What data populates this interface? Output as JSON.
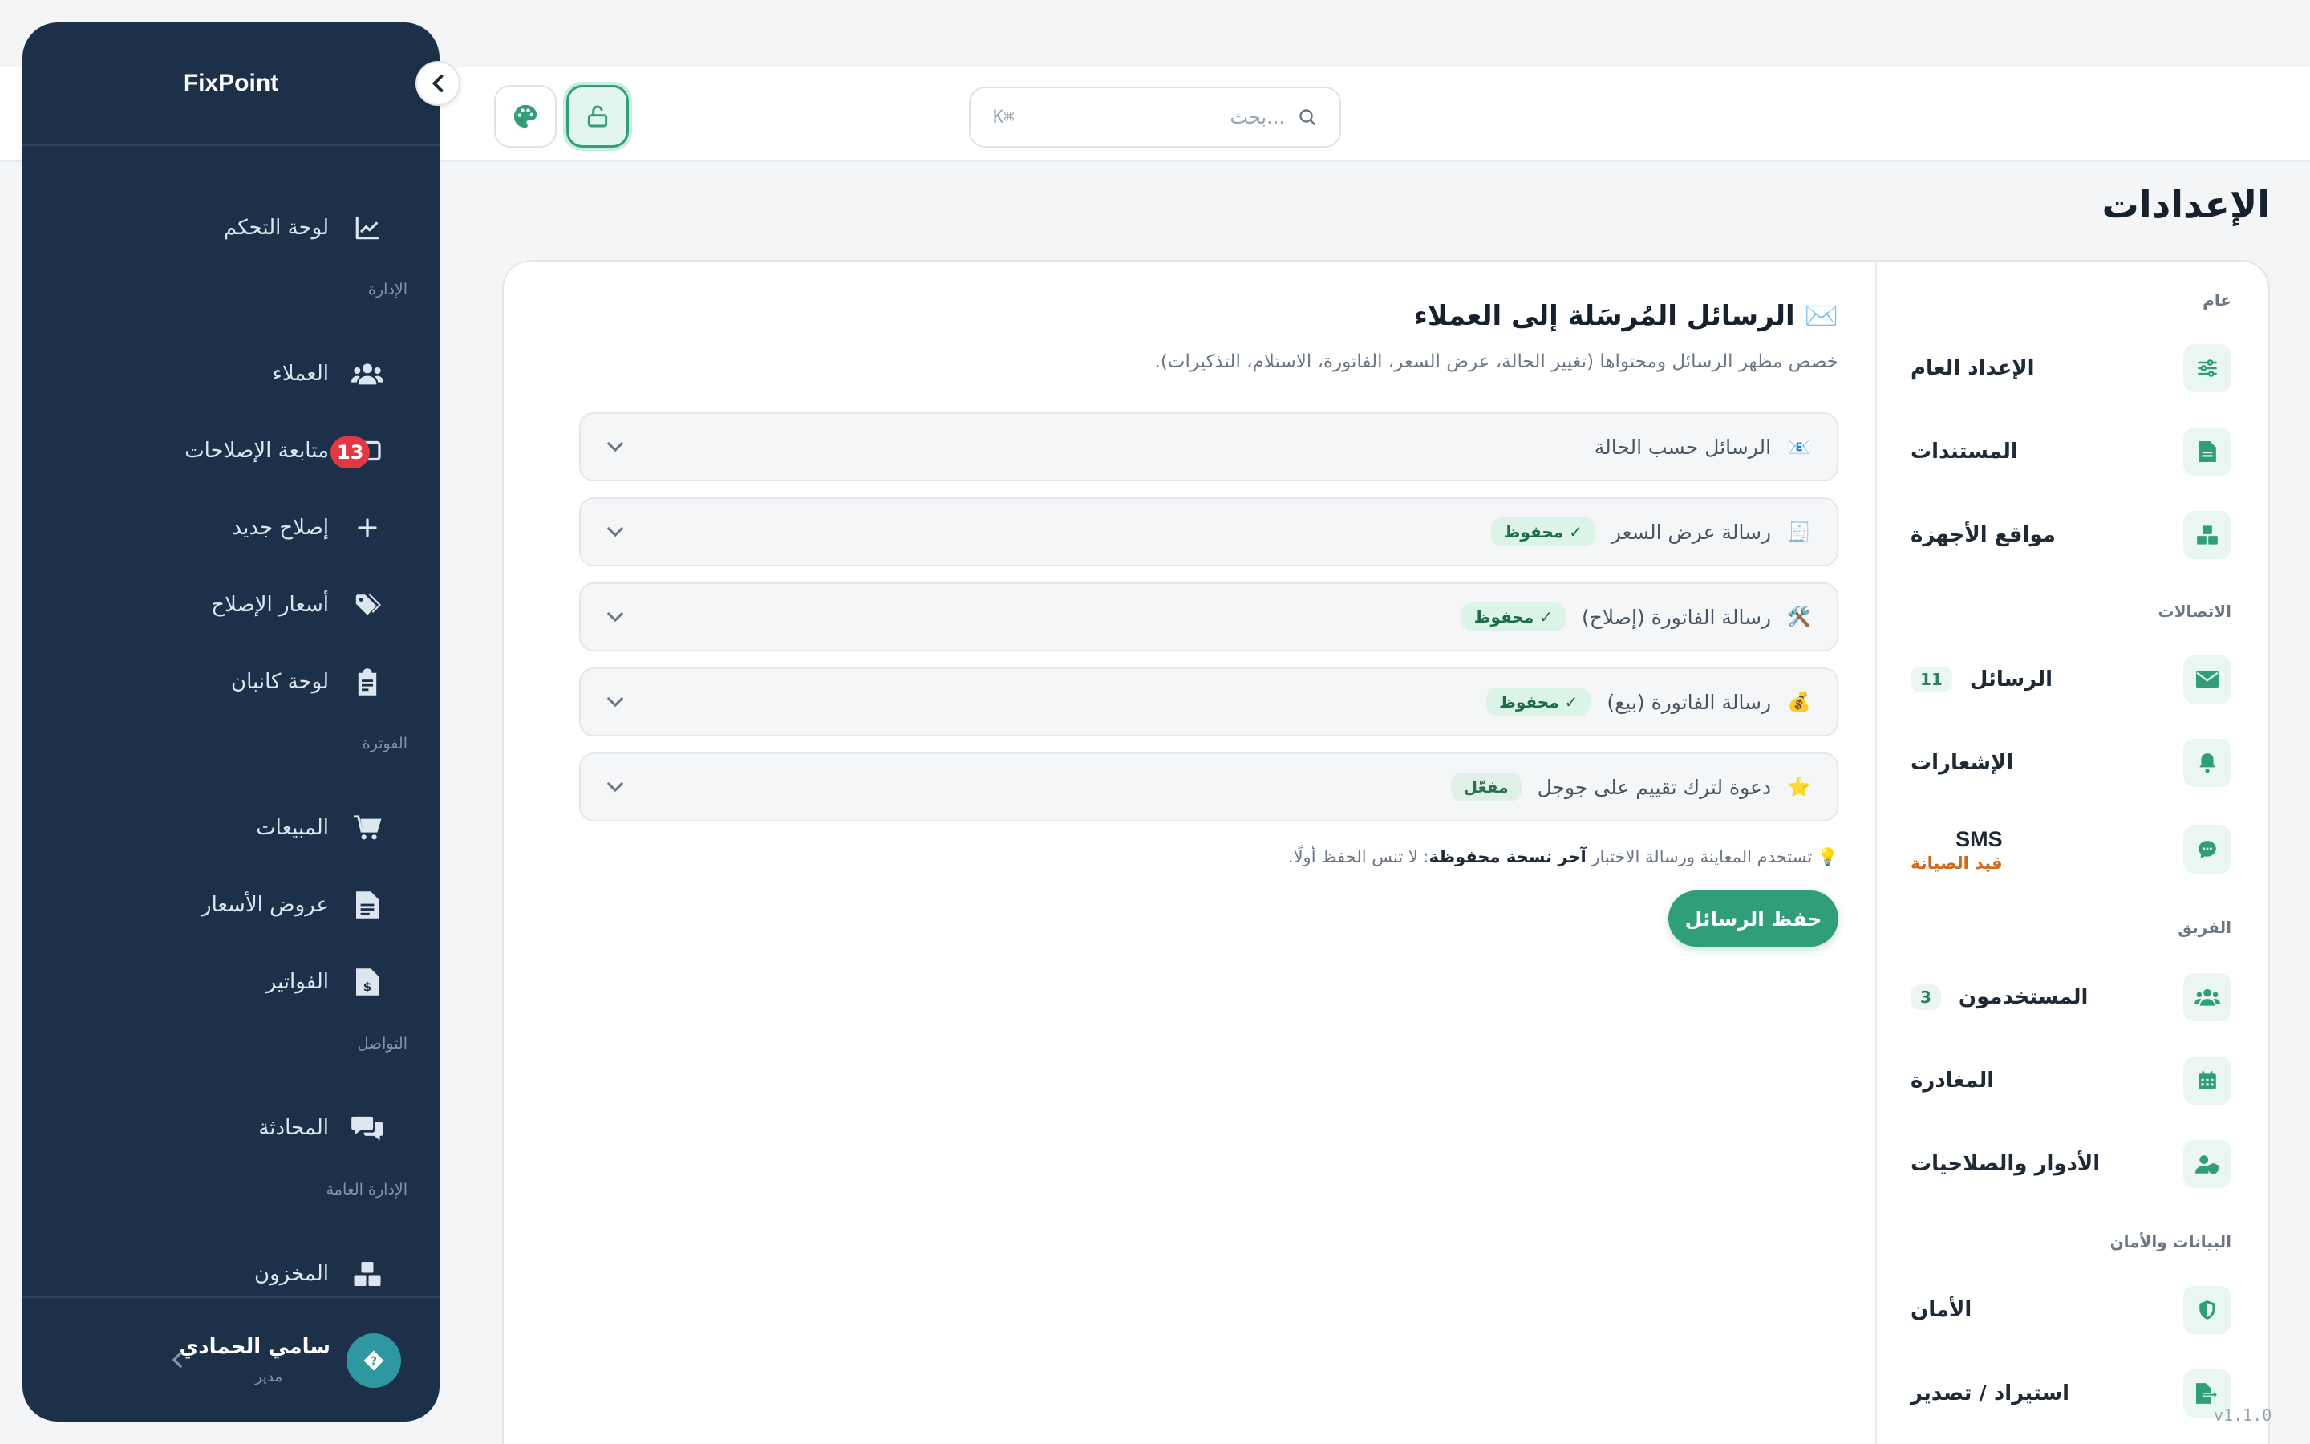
{
  "header": {
    "search_placeholder": "بحث...",
    "search_shortcut": "K⌘"
  },
  "sidebar": {
    "brand": "FixPoint",
    "items": [
      {
        "label": "لوحة التحكم",
        "icon": "chart-line-icon"
      },
      {
        "section": "الإدارة"
      },
      {
        "label": "العملاء",
        "icon": "users-icon"
      },
      {
        "label": "متابعة الإصلاحات",
        "icon": "ticket-icon",
        "badge": "13"
      },
      {
        "label": "إصلاح جديد",
        "icon": "plus-icon"
      },
      {
        "label": "أسعار الإصلاح",
        "icon": "tags-icon"
      },
      {
        "label": "لوحة كانبان",
        "icon": "clipboard-icon"
      },
      {
        "section": "الفوترة"
      },
      {
        "label": "المبيعات",
        "icon": "cart-icon"
      },
      {
        "label": "عروض الأسعار",
        "icon": "file-lines-icon"
      },
      {
        "label": "الفواتير",
        "icon": "invoice-dollar-icon"
      },
      {
        "section": "التواصل"
      },
      {
        "label": "المحادثة",
        "icon": "comments-icon"
      },
      {
        "section": "الإدارة العامة"
      },
      {
        "label": "المخزون",
        "icon": "boxes-icon"
      }
    ],
    "user": {
      "name": "سامي الحمادي",
      "role": "مدير"
    }
  },
  "page_title": "الإعدادات",
  "settings_nav": {
    "sections": [
      "عام",
      "الاتصالات",
      "الفريق",
      "البيانات والأمان"
    ],
    "items": [
      {
        "label": "الإعداد العام",
        "icon": "sliders-icon"
      },
      {
        "label": "المستندات",
        "icon": "file-icon"
      },
      {
        "label": "مواقع الأجهزة",
        "icon": "boxes-icon"
      },
      {
        "label": "الرسائل",
        "icon": "envelope-icon",
        "count": "11"
      },
      {
        "label": "الإشعارات",
        "icon": "bell-icon"
      },
      {
        "label": "SMS",
        "sub": "قيد الصيانة",
        "icon": "sms-icon"
      },
      {
        "label": "المستخدمون",
        "icon": "users-icon",
        "count": "3"
      },
      {
        "label": "المغادرة",
        "icon": "calendar-icon"
      },
      {
        "label": "الأدوار والصلاحيات",
        "icon": "user-shield-icon"
      },
      {
        "label": "الأمان",
        "icon": "shield-icon"
      },
      {
        "label": "استيراد / تصدير",
        "icon": "file-export-icon"
      }
    ]
  },
  "content": {
    "emoji": "✉️",
    "title": "الرسائل المُرسَلة إلى العملاء",
    "subtitle": "خصص مظهر الرسائل ومحتواها (تغيير الحالة، عرض السعر، الفاتورة، الاستلام، التذكيرات).",
    "accordions": [
      {
        "emoji": "📧",
        "label": "الرسائل حسب الحالة",
        "tag": ""
      },
      {
        "emoji": "🧾",
        "label": "رسالة عرض السعر",
        "tag": "✓ محفوظ"
      },
      {
        "emoji": "🛠️",
        "label": "رسالة الفاتورة (إصلاح)",
        "tag": "✓ محفوظ"
      },
      {
        "emoji": "💰",
        "label": "رسالة الفاتورة (بيع)",
        "tag": "✓ محفوظ"
      },
      {
        "emoji": "⭐",
        "label": "دعوة لترك تقييم على جوجل",
        "tag": "مفعّل"
      }
    ],
    "hint_prefix": "💡 تستخدم المعاينة ورسالة الاختبار",
    "hint_bold": "آخر نسخة محفوظة",
    "hint_suffix": ": لا تنس الحفظ أولًا.",
    "save_label": "حفظ الرسائل"
  },
  "version": "v1.1.0",
  "colors": {
    "sidebar": "#1c3149",
    "accent": "#2f9e79",
    "badge": "#e23745"
  }
}
